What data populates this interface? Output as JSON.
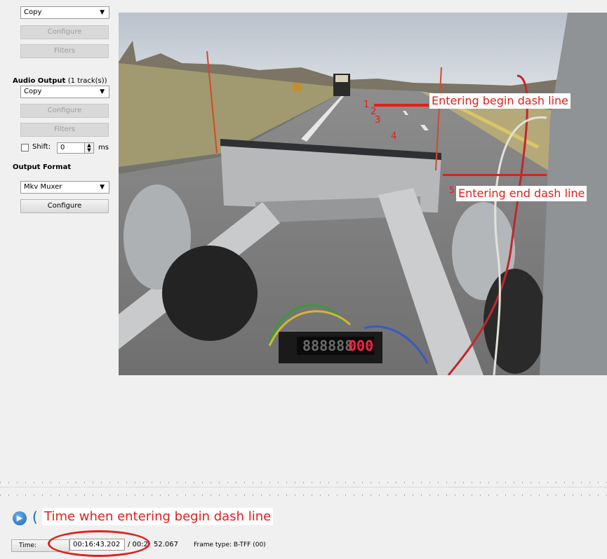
{
  "video_output": {
    "codec_value": "Copy",
    "configure_label": "Configure",
    "filters_label": "Filters"
  },
  "audio_output": {
    "title": "Audio Output",
    "subtitle": "(1 track(s))",
    "codec_value": "Copy",
    "configure_label": "Configure",
    "filters_label": "Filters",
    "shift_label": "Shift:",
    "shift_value": "0",
    "shift_unit": "ms"
  },
  "output_format": {
    "title": "Output Format",
    "muxer_value": "Mkv Muxer",
    "configure_label": "Configure"
  },
  "video_frame": {
    "odometer_white": "888888",
    "odometer_red": "000"
  },
  "annotations": {
    "begin_label": "Entering begin dash line",
    "end_label": "Entering end dash line",
    "marker_1": "1",
    "marker_2": "2",
    "marker_3": "3",
    "marker_4": "4",
    "marker_5": "5",
    "time_label": "Time when entering begin dash line",
    "accent_color": "#e0201c"
  },
  "status_bar": {
    "time_button_label": "Time:",
    "current_time": "00:16:43.202",
    "total_time": "/ 00:2",
    "total_time_tail": "52.067",
    "frame_type": "Frame type:  B-TFF (00)"
  },
  "icons": {
    "play": "play-circle-icon"
  }
}
